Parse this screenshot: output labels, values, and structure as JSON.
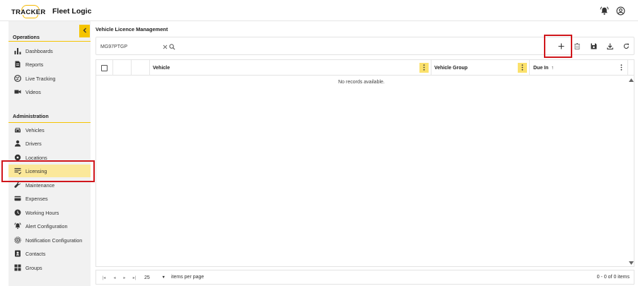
{
  "header": {
    "logo_word": "TRACKER",
    "logo_suffix": "Fleet Logic"
  },
  "sidebar": {
    "operations_title": "Operations",
    "operations": [
      {
        "label": "Dashboards",
        "icon": "bar-chart-icon"
      },
      {
        "label": "Reports",
        "icon": "document-icon"
      },
      {
        "label": "Live Tracking",
        "icon": "globe-icon"
      },
      {
        "label": "Videos",
        "icon": "video-camera-icon"
      }
    ],
    "administration_title": "Administration",
    "administration": [
      {
        "label": "Vehicles",
        "icon": "car-icon"
      },
      {
        "label": "Drivers",
        "icon": "person-icon"
      },
      {
        "label": "Locations",
        "icon": "location-pin-icon"
      },
      {
        "label": "Licensing",
        "icon": "licence-list-icon",
        "active": true
      },
      {
        "label": "Maintenance",
        "icon": "wrench-icon"
      },
      {
        "label": "Expenses",
        "icon": "card-icon"
      },
      {
        "label": "Working Hours",
        "icon": "clock-icon"
      },
      {
        "label": "Alert Configuration",
        "icon": "alarm-bell-icon"
      },
      {
        "label": "Notification Configuration",
        "icon": "notification-cog-icon"
      },
      {
        "label": "Contacts",
        "icon": "contact-book-icon"
      },
      {
        "label": "Groups",
        "icon": "groups-icon"
      }
    ]
  },
  "main": {
    "title": "Vehicle Licence Management",
    "search": {
      "value": "MG97PTGP",
      "placeholder": ""
    },
    "grid": {
      "columns": [
        {
          "label": "Vehicle"
        },
        {
          "label": "Vehicle Group"
        },
        {
          "label": "Due In",
          "sort": "↑"
        }
      ],
      "empty_message": "No records available."
    },
    "pager": {
      "page_size": "25",
      "items_per_page_label": "items per page",
      "count_text": "0 - 0 of 0 items"
    }
  },
  "colors": {
    "accent": "#f5c400",
    "active_bg": "#fbe89a",
    "highlight": "#d0161b"
  }
}
